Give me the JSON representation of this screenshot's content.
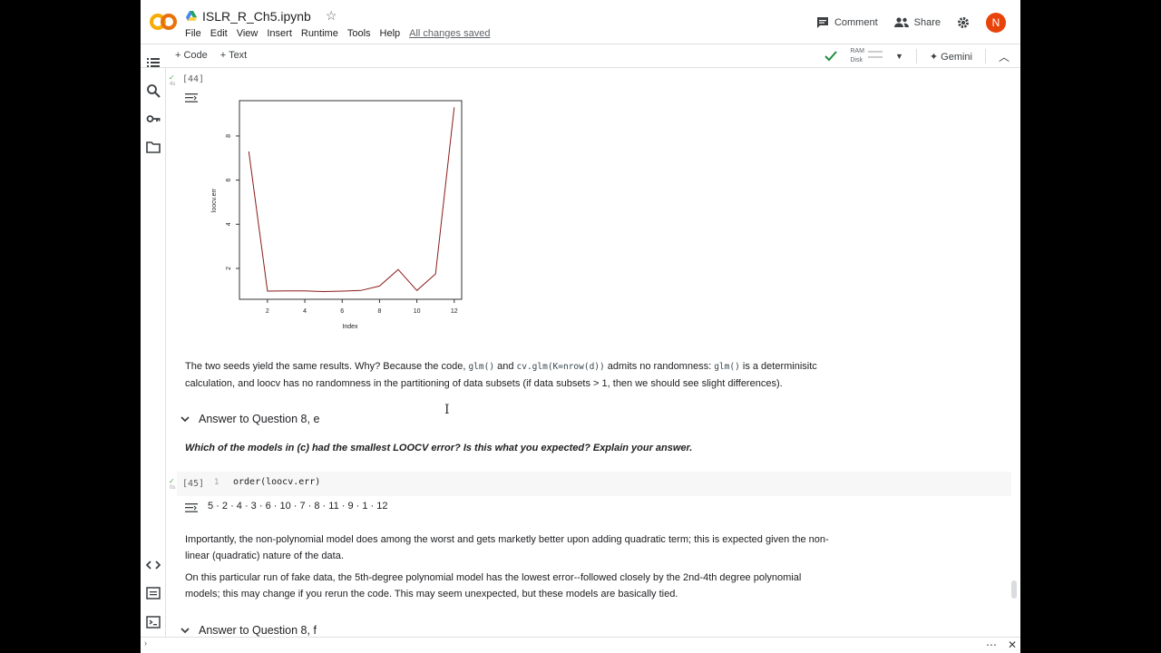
{
  "header": {
    "notebook_title": "ISLR_R_Ch5.ipynb",
    "menu": [
      "File",
      "Edit",
      "View",
      "Insert",
      "Runtime",
      "Tools",
      "Help"
    ],
    "save_status": "All changes saved",
    "comment_label": "Comment",
    "share_label": "Share",
    "avatar_letter": "N",
    "avatar_color": "#e8430a"
  },
  "toolbar": {
    "add_code": "+ Code",
    "add_text": "+ Text",
    "ram_label": "RAM",
    "disk_label": "Disk",
    "gemini_label": "Gemini"
  },
  "cells": {
    "cell44": {
      "exec": "[44]",
      "time": "4s"
    },
    "cell45": {
      "exec": "[45]",
      "time": "0s",
      "line_no": "1",
      "code": "order(loocv.err)",
      "output": "5 · 2 · 4 · 3 · 6 · 10 · 7 · 8 · 11 · 9 · 1 · 12"
    }
  },
  "markdown": {
    "p1_a": "The two seeds yield the same results. Why? Because the code, ",
    "p1_code1": "glm()",
    "p1_b": " and ",
    "p1_code2": "cv.glm(K=nrow(d))",
    "p1_c": " admits no randomness: ",
    "p1_code3": "glm()",
    "p1_d": " is a determinisitc calculation, and loocv has no randomness in the partitioning of data subsets (if data subsets > 1, then we should see slight differences).",
    "section_e": "Answer to Question 8, e",
    "question_e": "Which of the models in (c) had the smallest LOOCV error? Is this what you expected? Explain your answer.",
    "p2": "Importantly, the non-polynomial model does among the worst and gets marketly better upon adding quadratic term; this is expected given the non-linear (quadratic) nature of the data.",
    "p3": "On this particular run of fake data, the 5th-degree polynomial model has the lowest error--followed closely by the 2nd-4th degree polynomial models; this may change if you rerun the code. This may seem unexpected, but these models are basically tied.",
    "section_f": "Answer to Question 8, f"
  },
  "chart_data": {
    "type": "line",
    "x": [
      1,
      2,
      3,
      4,
      5,
      6,
      7,
      8,
      9,
      10,
      11,
      12
    ],
    "y": [
      7.3,
      0.97,
      0.98,
      0.98,
      0.95,
      0.97,
      1.0,
      1.2,
      1.95,
      1.0,
      1.75,
      9.3
    ],
    "xlabel": "Index",
    "ylabel": "loocv.err",
    "xticks": [
      "2",
      "4",
      "6",
      "8",
      "10",
      "12"
    ],
    "yticks": [
      "2",
      "4",
      "6",
      "8"
    ],
    "xlim": [
      0.5,
      12.4
    ],
    "ylim": [
      0.6,
      9.6
    ],
    "line_color": "#8b1a1a"
  }
}
